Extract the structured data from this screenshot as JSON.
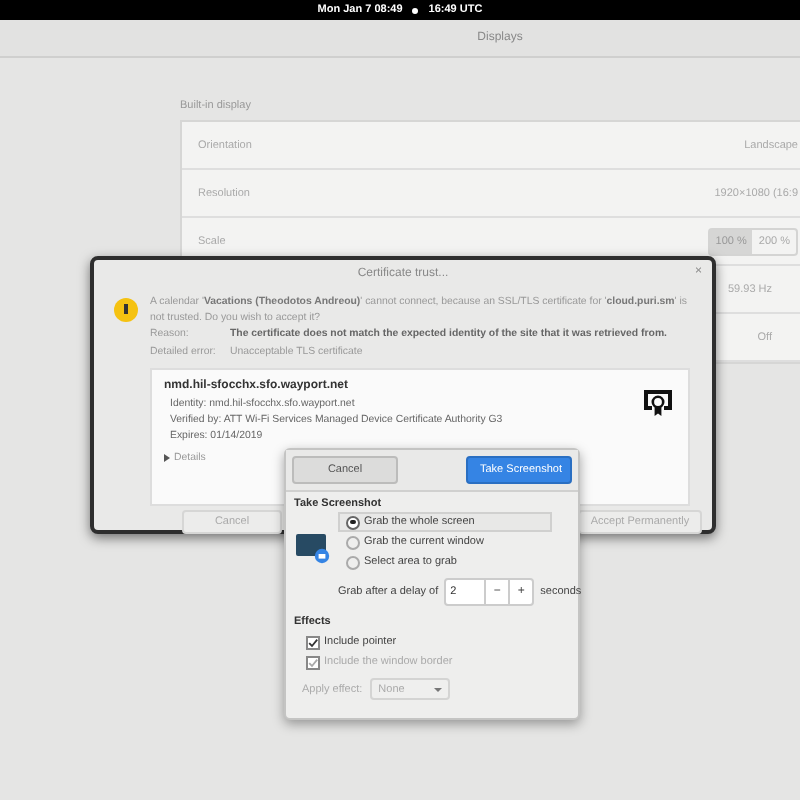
{
  "top_bar": {
    "date_time": "Mon Jan 7  08:49",
    "utc_time": "16:49 UTC"
  },
  "settings": {
    "title": "Displays",
    "section": "Built-in display",
    "rows": [
      {
        "kind": "value",
        "label": "Orientation",
        "value": "Landscape"
      },
      {
        "kind": "value",
        "label": "Resolution",
        "value": "1920×1080 (16:9"
      },
      {
        "kind": "scale",
        "label": "Scale",
        "options": [
          {
            "label": "100 %",
            "selected": true
          },
          {
            "label": "200 %",
            "selected": false
          }
        ]
      },
      {
        "kind": "value",
        "value": "59.93 Hz"
      },
      {
        "kind": "value",
        "value": "Off"
      }
    ]
  },
  "certificate_dialog": {
    "title": "Certificate trust...",
    "close": "×",
    "message": "A calendar '**Vacations (Theodotos Andreou)**' cannot connect, because an SSL/TLS certificate for '**cloud.puri.sm**' is not trusted. Do you wish to accept it?",
    "reason_label": "Reason:",
    "reason": "The certificate does not match the expected identity of the site that it was retrieved from.",
    "error_label": "Detailed error:",
    "error": "Unacceptable TLS certificate",
    "certificate": {
      "host": "nmd.hil-sfocchx.sfo.wayport.net",
      "identity": "Identity: nmd.hil-sfocchx.sfo.wayport.net",
      "verified_by": "Verified by: ATT Wi-Fi Services Managed Device Certificate Authority G3",
      "expires": "Expires: 01/14/2019",
      "details": "Details"
    },
    "buttons": [
      "Cancel",
      "Accept Permanently"
    ]
  },
  "screenshot_dialog": {
    "cancel": "Cancel",
    "take": "Take Screenshot",
    "heading": "Take Screenshot",
    "options": [
      {
        "label": "Grab the whole screen",
        "selected": true
      },
      {
        "label": "Grab the current window",
        "selected": false
      },
      {
        "label": "Select area to grab",
        "selected": false
      }
    ],
    "delay_label": "Grab after a delay of",
    "delay": "2",
    "minus": "−",
    "plus": "+",
    "seconds": "seconds",
    "effects": "Effects",
    "checks": [
      {
        "label": "Include pointer",
        "checked": true,
        "disabled": false
      },
      {
        "label": "Include the window border",
        "checked": true,
        "disabled": true
      }
    ],
    "apply_label": "Apply effect:",
    "apply_value": "None",
    "apply_disabled": true
  }
}
